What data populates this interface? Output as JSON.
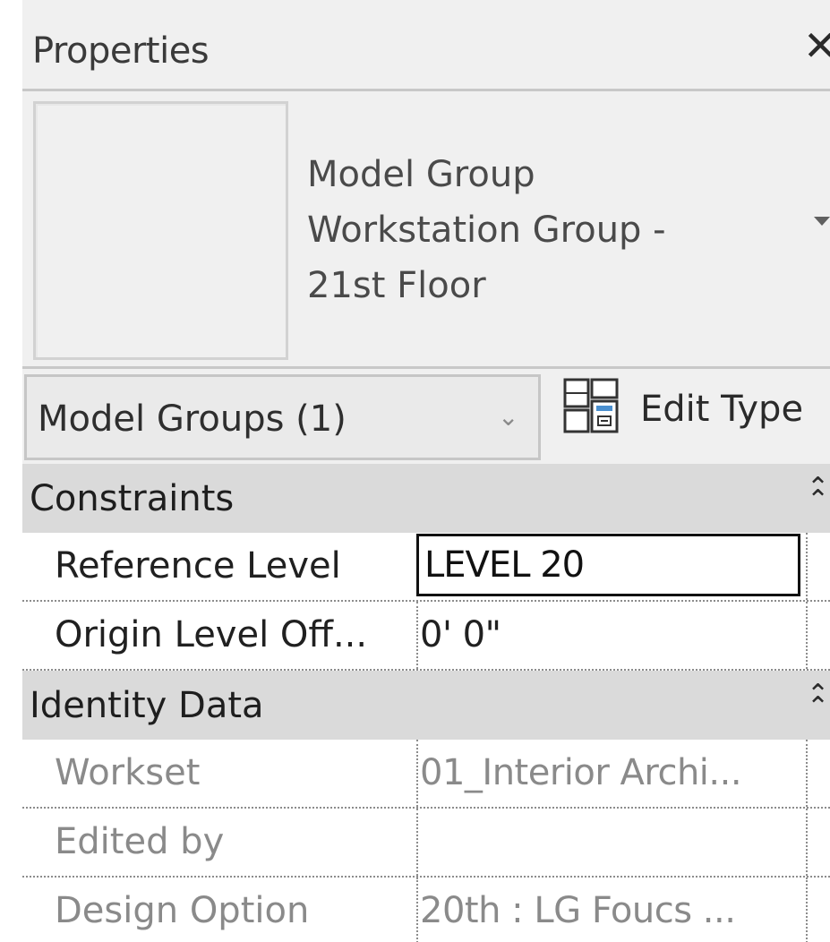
{
  "header": {
    "title": "Properties",
    "close_glyph": "✕"
  },
  "type_selector": {
    "line1": "Model Group",
    "line2": "Workstation Group -",
    "line3": "21st Floor"
  },
  "filter": {
    "selected": "Model Groups (1)",
    "chevron": "⌄",
    "edit_type_label": "Edit Type"
  },
  "groups": [
    {
      "label": "Constraints",
      "collapse_glyph": "⌃",
      "rows": [
        {
          "name": "Reference Level",
          "value": "LEVEL 20"
        },
        {
          "name": "Origin Level Off...",
          "value": "0'  0\""
        }
      ]
    },
    {
      "label": "Identity Data",
      "collapse_glyph": "⌃",
      "rows": [
        {
          "name": "Workset",
          "value": "01_Interior Archi..."
        },
        {
          "name": "Edited by",
          "value": ""
        },
        {
          "name": "Design Option",
          "value": "20th : LG Foucs ..."
        }
      ]
    }
  ],
  "icons": {
    "close": "close-icon",
    "type_dropdown": "dropdown-arrow-icon",
    "filter_chevron": "chevron-down-icon",
    "edit_type": "edit-type-icon",
    "collapse": "double-chevron-up-icon"
  },
  "colors": {
    "panel_bg": "#f0f0f0",
    "group_header_bg": "#dadada",
    "readonly_text": "#8a8a8a"
  }
}
